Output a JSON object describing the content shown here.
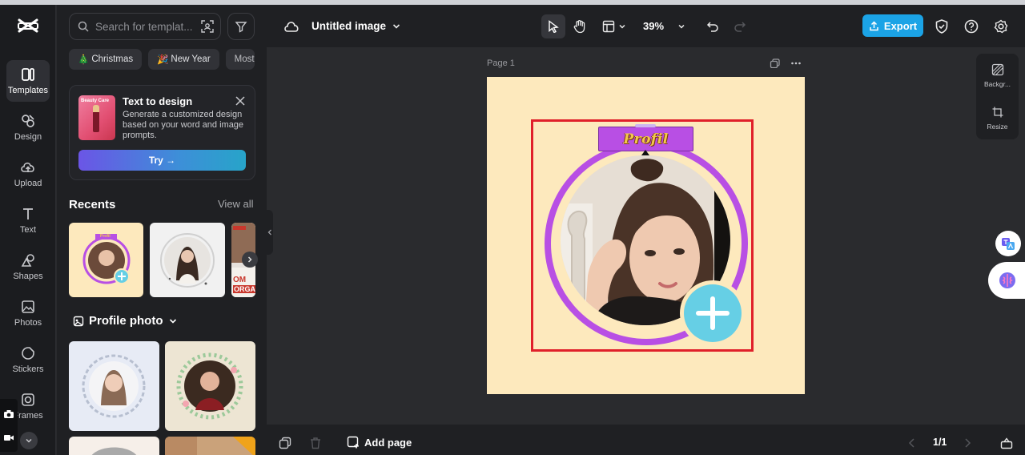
{
  "app": {
    "document_title": "Untitled image",
    "zoom": "39%"
  },
  "rail": {
    "items": [
      {
        "label": "Templates",
        "icon": "templates-icon",
        "active": true
      },
      {
        "label": "Design",
        "icon": "design-icon",
        "active": false
      },
      {
        "label": "Upload",
        "icon": "upload-icon",
        "active": false
      },
      {
        "label": "Text",
        "icon": "text-icon",
        "active": false
      },
      {
        "label": "Shapes",
        "icon": "shapes-icon",
        "active": false
      },
      {
        "label": "Photos",
        "icon": "photos-icon",
        "active": false
      },
      {
        "label": "Stickers",
        "icon": "stickers-icon",
        "active": false
      },
      {
        "label": "Frames",
        "icon": "frames-icon",
        "active": false
      }
    ]
  },
  "panel": {
    "search_placeholder": "Search for templat...",
    "chips": [
      {
        "emoji": "🎄",
        "label": "Christmas"
      },
      {
        "emoji": "🎉",
        "label": "New Year"
      },
      {
        "emoji": "",
        "label": "Most"
      }
    ],
    "promo": {
      "title": "Text to design",
      "description": "Generate a customized design based on your word and image prompts.",
      "button": "Try →",
      "thumb_text": "Beauty Care"
    },
    "recents_title": "Recents",
    "view_all": "View all",
    "recent_thumb_texts": {
      "first": "Profil",
      "third_line1": "OM",
      "third_line2": "ORGA"
    },
    "profile_section": "Profile photo"
  },
  "toolbar": {
    "export_label": "Export"
  },
  "canvas": {
    "page_label": "Page 1",
    "banner_text": "Profil"
  },
  "right_tools": {
    "background_label": "Backgr...",
    "resize_label": "Resize"
  },
  "bottom": {
    "add_page": "Add page",
    "pager": "1/1"
  },
  "colors": {
    "accent": "#1ba3e6",
    "artboard_bg": "#fde9bd",
    "ring": "#b84fe4",
    "plus_badge": "#66cfe5",
    "selection": "#e0202a",
    "banner_text": "#f2c94c"
  }
}
